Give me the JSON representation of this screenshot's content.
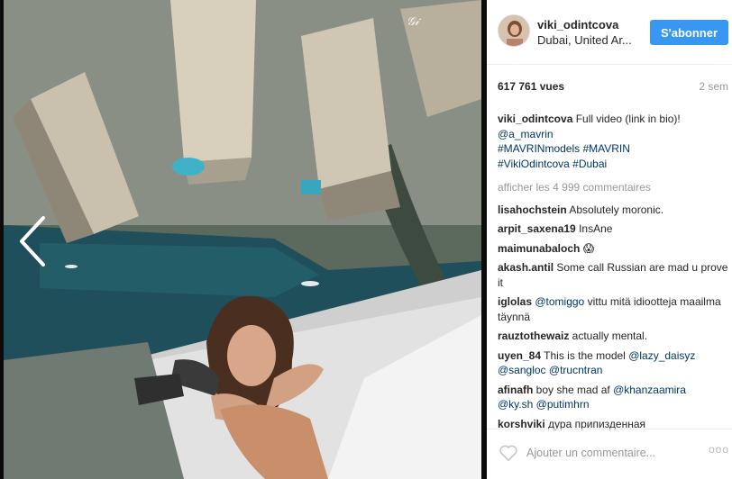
{
  "post": {
    "username": "viki_odintcova",
    "location": "Dubai, United Ar...",
    "follow_label": "S'abonner",
    "views": "617 761 vues",
    "time": "2 sem"
  },
  "caption": {
    "user": "viki_odintcova",
    "text_1": " Full video (link in bio)!",
    "mention": "@a_mavrin",
    "tags_1": "#MAVRINmodels #MAVRIN",
    "tags_2": "#VikiOdintcova #Dubai"
  },
  "load_more": "afficher les 4 999 commentaires",
  "comments": [
    {
      "user": "lisahochstein",
      "text": " Absolutely moronic."
    },
    {
      "user": "arpit_saxena19",
      "text": " InsAne"
    },
    {
      "user": "maimunabaloch",
      "text": " 😱"
    },
    {
      "user": "akash.antil",
      "text": " Some call Russian are mad u prove it"
    },
    {
      "user": "iglolas",
      "mention": "@tomiggo",
      "text": " vittu mitä idiootteja maailma täynnä"
    },
    {
      "user": "rauztothewaiz",
      "text": " actually mental."
    },
    {
      "user": "uyen_84",
      "text": " This is the model ",
      "mention": "@lazy_daisyz",
      "mention2": "@sangloc",
      "mention3": "@trucntran"
    },
    {
      "user": "afinafh",
      "text": " boy she mad af ",
      "mention": "@khanzaamira",
      "mention2": "@ky.sh",
      "mention3": "@putimhrn"
    },
    {
      "user": "korshviki",
      "text": " дура припизденная"
    }
  ],
  "footer": {
    "placeholder": "Ajouter un commentaire...",
    "more": "ooo"
  },
  "colors": {
    "follow_blue": "#3897f0",
    "link": "#003569",
    "muted": "#999999"
  },
  "icons": {
    "prev": "chevron-left-icon",
    "next": "chevron-right-icon",
    "like": "heart-outline-icon"
  }
}
